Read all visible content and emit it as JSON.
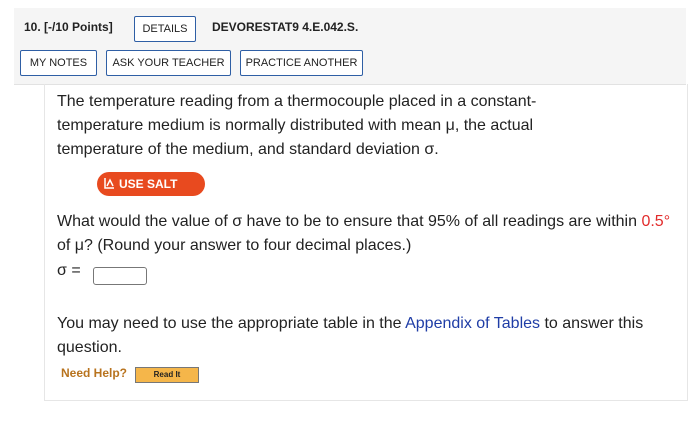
{
  "header": {
    "question_number": "10. [-/10 Points]",
    "details_label": "DETAILS",
    "code": "DEVORESTAT9 4.E.042.S.",
    "my_notes_label": "MY NOTES",
    "ask_teacher_label": "ASK YOUR TEACHER",
    "practice_label": "PRACTICE ANOTHER"
  },
  "question": {
    "paragraph1": "The temperature reading from a thermocouple placed in a constant-temperature medium is normally distributed with mean μ, the actual temperature of the medium, and standard deviation σ.",
    "salt_label": "USE SALT",
    "p2_before": "What would the value of σ have to be to ensure that 95% of all readings are within ",
    "p2_highlight": "0.5°",
    "p2_after": " of μ? (Round your answer to four decimal places.)",
    "sigma_label": "σ =",
    "answer_value": "",
    "p3_before": "You may need to use the appropriate table in the ",
    "p3_link": "Appendix of Tables",
    "p3_after": " to answer this question."
  },
  "help": {
    "need_help_label": "Need Help?",
    "read_it_label": "Read It"
  },
  "colors": {
    "accent_blue": "#2f5fa5",
    "salt_orange": "#e84a1f",
    "highlight_red": "#e22b2b",
    "link_blue": "#1f3da6",
    "help_orange": "#b8731e"
  }
}
